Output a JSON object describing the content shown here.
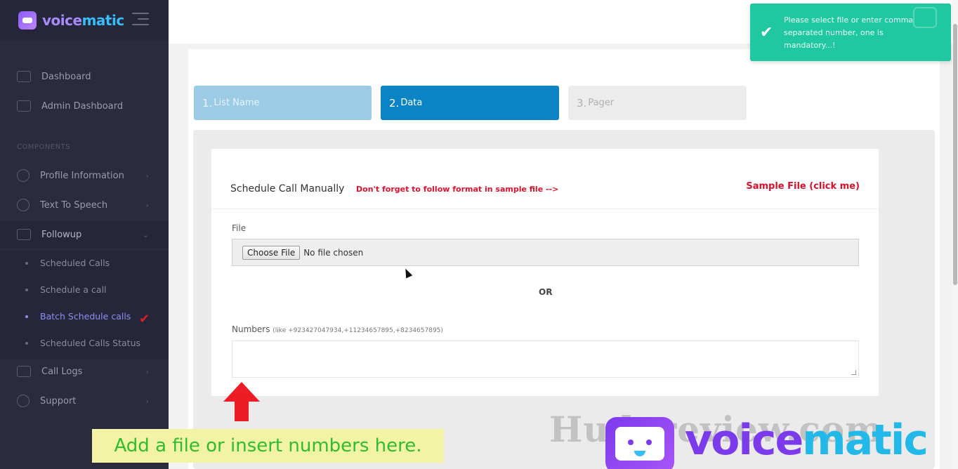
{
  "app": {
    "brand_part1": "voice",
    "brand_part2": "matic"
  },
  "sidebar": {
    "items": [
      {
        "label": "Dashboard",
        "icon": "monitor-icon"
      },
      {
        "label": "Admin Dashboard",
        "icon": "sliders-icon"
      }
    ],
    "section_label": "COMPONENTS",
    "components": [
      {
        "label": "Profile Information",
        "icon": "user-icon"
      },
      {
        "label": "Text To Speech",
        "icon": "database-icon"
      },
      {
        "label": "Followup",
        "icon": "bell-icon"
      }
    ],
    "followup_sub": [
      {
        "label": "Scheduled Calls"
      },
      {
        "label": "Schedule a call"
      },
      {
        "label": "Batch Schedule calls"
      },
      {
        "label": "Scheduled Calls Status"
      }
    ],
    "bottom": [
      {
        "label": "Call Logs",
        "icon": "calendar-icon"
      },
      {
        "label": "Support",
        "icon": "support-icon"
      }
    ]
  },
  "wizard": {
    "steps": [
      {
        "num": "1.",
        "label": "List Name"
      },
      {
        "num": "2.",
        "label": "Data"
      },
      {
        "num": "3.",
        "label": "Pager"
      }
    ]
  },
  "card": {
    "title": "Schedule Call Manually",
    "note": "Don't forget to follow format in sample file -->",
    "sample_link": "Sample File (click me)",
    "file_label": "File",
    "file_button": "Choose File",
    "file_status": "No file chosen",
    "or_label": "OR",
    "numbers_label": "Numbers",
    "numbers_hint": "(like +923427047934,+11234657895,+8234657895)"
  },
  "toast": {
    "message": "Please select file or enter comma separated number, one is mandatory...!"
  },
  "overlay": {
    "caption": "Add a file or insert numbers here.",
    "watermark": "Hudareview.com",
    "brand_part1": "voice",
    "brand_part2": "matic"
  },
  "colors": {
    "sidebar_bg": "#2b2b3d",
    "step_active": "#0b84c6",
    "step_done": "#9ccbe6",
    "toast_bg": "#1fc8a0",
    "accent_red": "#e0102c"
  }
}
